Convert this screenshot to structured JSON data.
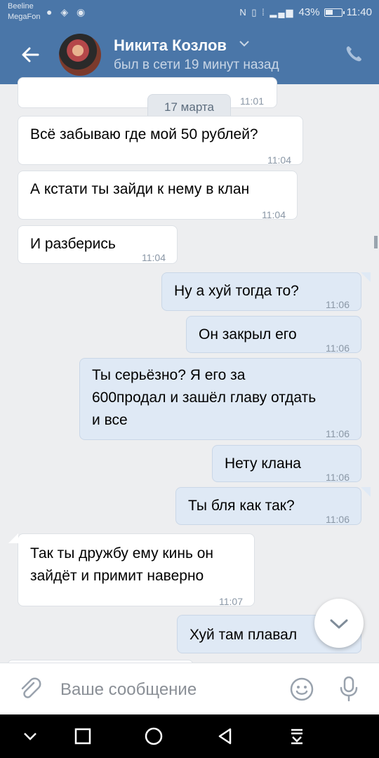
{
  "statusbar": {
    "carrier1": "Beeline",
    "carrier2": "MegaFon",
    "battery": "43%",
    "time": "11:40"
  },
  "header": {
    "name": "Никита Козлов",
    "status": "был в сети 19 минут назад"
  },
  "date_separator": "17 марта",
  "messages": [
    {
      "dir": "in",
      "text": "",
      "time": "11:01"
    },
    {
      "dir": "in",
      "text": "Всё забываю где мой 50 рублей?",
      "time": "11:04"
    },
    {
      "dir": "in",
      "text": "А кстати ты зайди к нему в клан",
      "time": "11:04"
    },
    {
      "dir": "in",
      "text": "И разберись",
      "time": "11:04"
    },
    {
      "dir": "out",
      "text": "Ну а хуй тогда то?",
      "time": "11:06"
    },
    {
      "dir": "out",
      "text": "Он закрыл его",
      "time": "11:06"
    },
    {
      "dir": "out",
      "lines": [
        "Ты серьёзно? Я его за",
        "600продал и зашёл главу отдать",
        "и все"
      ],
      "time": "11:06"
    },
    {
      "dir": "out",
      "text": "Нету клана",
      "time": "11:06"
    },
    {
      "dir": "out",
      "text": "Ты бля как так?",
      "time": "11:06"
    },
    {
      "dir": "in",
      "lines": [
        "Так ты дружбу ему кинь он",
        "зайдёт и примит наверно"
      ],
      "time": "11:07"
    },
    {
      "dir": "out",
      "text": "Хуй там плавал",
      "time": ""
    }
  ],
  "composer": {
    "placeholder": "Ваше сообщение"
  },
  "colors": {
    "accent": "#4a76a8",
    "background": "#edeef0",
    "outgoing_bubble": "#dfe9f5"
  },
  "icons": [
    "back-arrow-icon",
    "chevron-down-icon",
    "phone-icon",
    "paperclip-icon",
    "emoji-icon",
    "microphone-icon",
    "scroll-down-icon",
    "nav-back-icon",
    "nav-home-icon",
    "nav-recents-icon"
  ]
}
